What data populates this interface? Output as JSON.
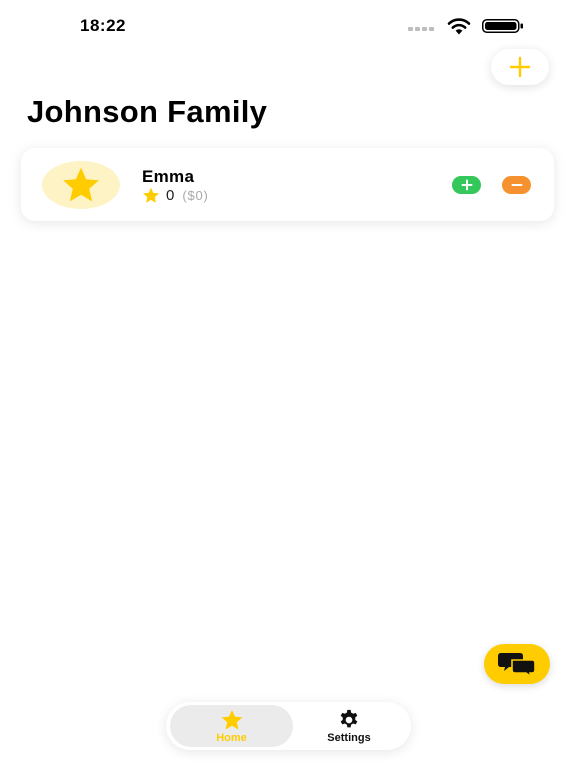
{
  "status_bar": {
    "time": "18:22"
  },
  "header": {
    "title": "Johnson Family"
  },
  "members": [
    {
      "name": "Emma",
      "points": "0",
      "money": "($0)"
    }
  ],
  "tab_bar": {
    "tabs": [
      {
        "label": "Home",
        "icon": "star-icon",
        "active": true
      },
      {
        "label": "Settings",
        "icon": "gear-icon",
        "active": false
      }
    ]
  },
  "colors": {
    "accent": "#ffcc00",
    "plus": "#34c759",
    "minus": "#f5922f",
    "avatar_bg": "#fdf3c4"
  }
}
